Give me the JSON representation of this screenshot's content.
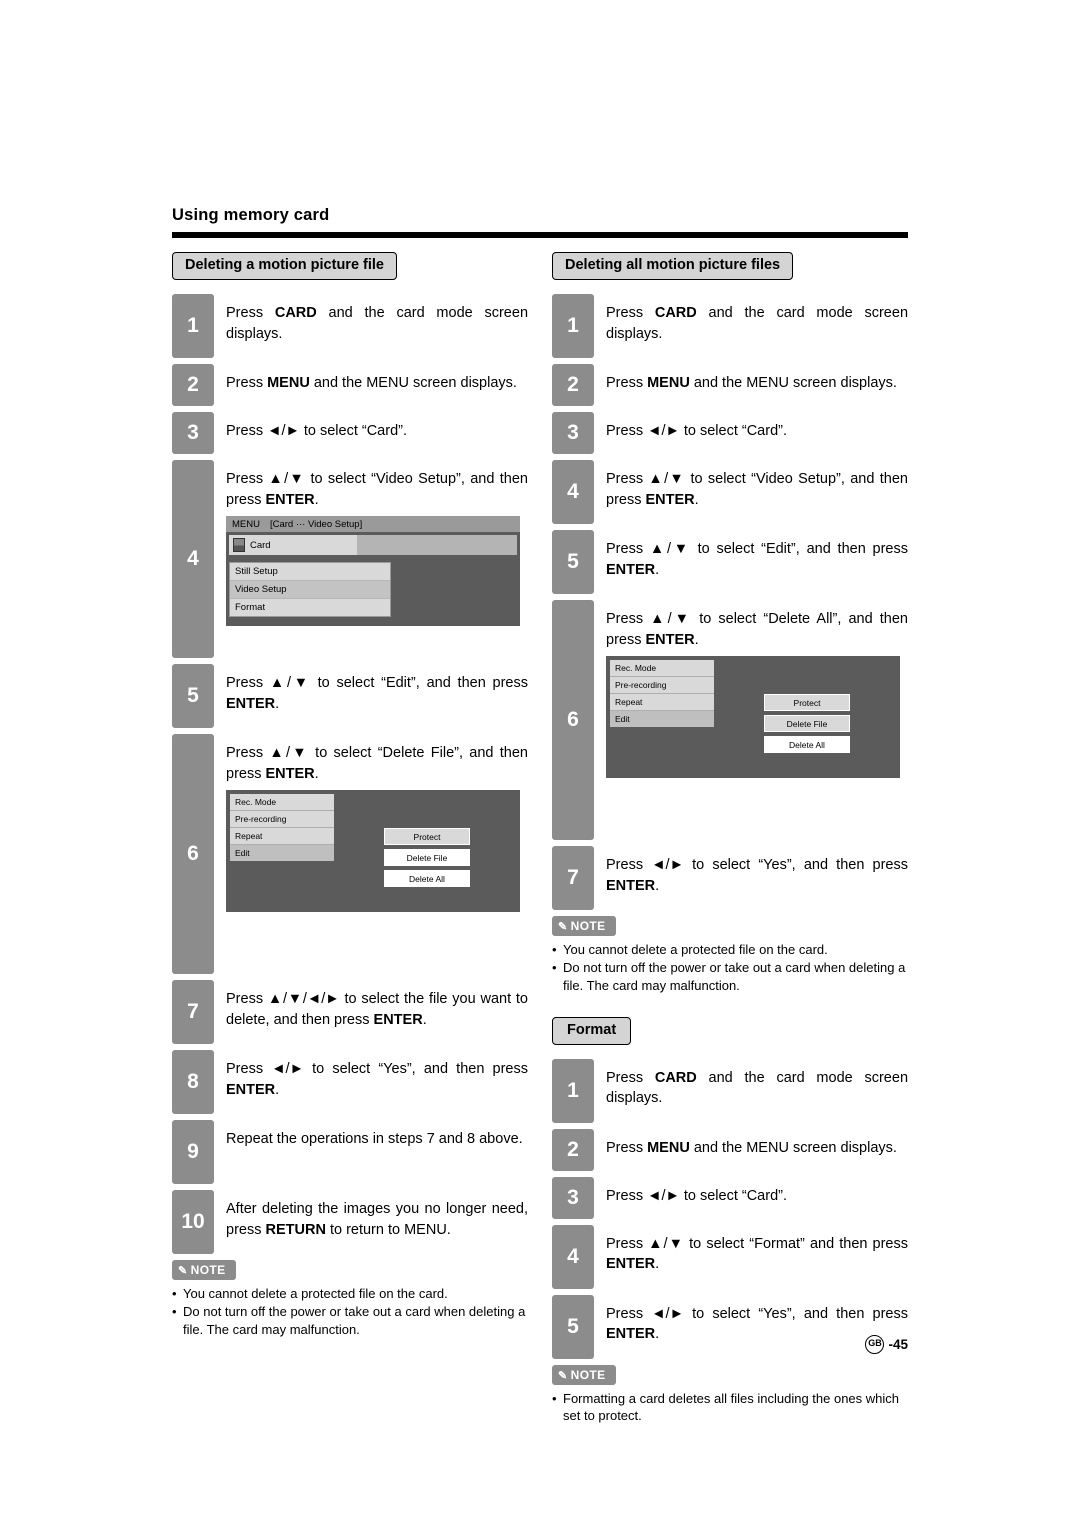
{
  "running_head": "Using memory card",
  "page_number": "-45",
  "page_mark": "GB",
  "sections": {
    "left": {
      "title": "Deleting a motion picture file",
      "steps": [
        {
          "num": "1",
          "text_html": "Press <b>CARD</b> and the card mode screen displays."
        },
        {
          "num": "2",
          "text_html": "Press <b>MENU</b> and the MENU screen displays."
        },
        {
          "num": "3",
          "text_html": "Press ◄/► to select “Card”."
        },
        {
          "num": "4",
          "text_html": "Press ▲/▼ to select “Video Setup”, and then press <b>ENTER</b>."
        },
        {
          "num": "5",
          "text_html": "Press ▲/▼ to select “Edit”, and then press <b>ENTER</b>."
        },
        {
          "num": "6",
          "text_html": "Press ▲/▼ to select “Delete File”, and then press <b>ENTER</b>."
        },
        {
          "num": "7",
          "text_html": "Press ▲/▼/◄/► to select the file you want to delete, and then press <b>ENTER</b>."
        },
        {
          "num": "8",
          "text_html": "Press ◄/► to select “Yes”, and then press <b>ENTER</b>."
        },
        {
          "num": "9",
          "text_html": "Repeat the operations in steps 7 and 8 above."
        },
        {
          "num": "10",
          "text_html": "After deleting the images you no longer need, press <b>RETURN</b> to return to MENU."
        }
      ],
      "osd_menu": {
        "menu_label": "MENU",
        "path_label": "[Card ··· Video Setup]",
        "card_label": "Card",
        "items": [
          "Still Setup",
          "Video Setup",
          "Format"
        ],
        "selected": "Video Setup"
      },
      "osd_edit": {
        "left_items": [
          "Rec. Mode",
          "Pre-recording",
          "Repeat",
          "Edit"
        ],
        "left_selected": "Edit",
        "right_items": [
          "Protect",
          "Delete File",
          "Delete All"
        ],
        "right_selected": "Delete File"
      },
      "note": {
        "label": "NOTE",
        "items": [
          "You cannot delete a protected file on the card.",
          "Do not turn off the power or take out a card when deleting a file. The card may malfunction."
        ]
      }
    },
    "right": {
      "title": "Deleting all motion picture files",
      "steps": [
        {
          "num": "1",
          "text_html": "Press <b>CARD</b> and the card mode screen displays."
        },
        {
          "num": "2",
          "text_html": "Press <b>MENU</b> and the MENU screen displays."
        },
        {
          "num": "3",
          "text_html": "Press ◄/► to select “Card”."
        },
        {
          "num": "4",
          "text_html": "Press ▲/▼ to select “Video Setup”, and then press <b>ENTER</b>."
        },
        {
          "num": "5",
          "text_html": "Press ▲/▼ to select “Edit”, and then press <b>ENTER</b>."
        },
        {
          "num": "6",
          "text_html": "Press ▲/▼ to select “Delete All”, and then press <b>ENTER</b>."
        },
        {
          "num": "7",
          "text_html": "Press ◄/► to select “Yes”, and then press <b>ENTER</b>."
        }
      ],
      "osd_edit": {
        "left_items": [
          "Rec. Mode",
          "Pre-recording",
          "Repeat",
          "Edit"
        ],
        "left_selected": "Edit",
        "right_items": [
          "Protect",
          "Delete File",
          "Delete All"
        ],
        "right_selected": "Delete All"
      },
      "note": {
        "label": "NOTE",
        "items": [
          "You cannot delete a protected file on the card.",
          "Do not turn off the power or take out a card when deleting a file. The card may malfunction."
        ]
      }
    },
    "format": {
      "title": "Format",
      "steps": [
        {
          "num": "1",
          "text_html": "Press <b>CARD</b> and the card mode screen displays."
        },
        {
          "num": "2",
          "text_html": "Press <b>MENU</b> and the MENU screen displays."
        },
        {
          "num": "3",
          "text_html": "Press ◄/► to select “Card”."
        },
        {
          "num": "4",
          "text_html": "Press ▲/▼ to select “Format” and then press <b>ENTER</b>."
        },
        {
          "num": "5",
          "text_html": "Press ◄/► to select “Yes”, and then press <b>ENTER</b>."
        }
      ],
      "note": {
        "label": "NOTE",
        "items": [
          "Formatting a card deletes all files including the ones which set to protect."
        ]
      }
    }
  }
}
